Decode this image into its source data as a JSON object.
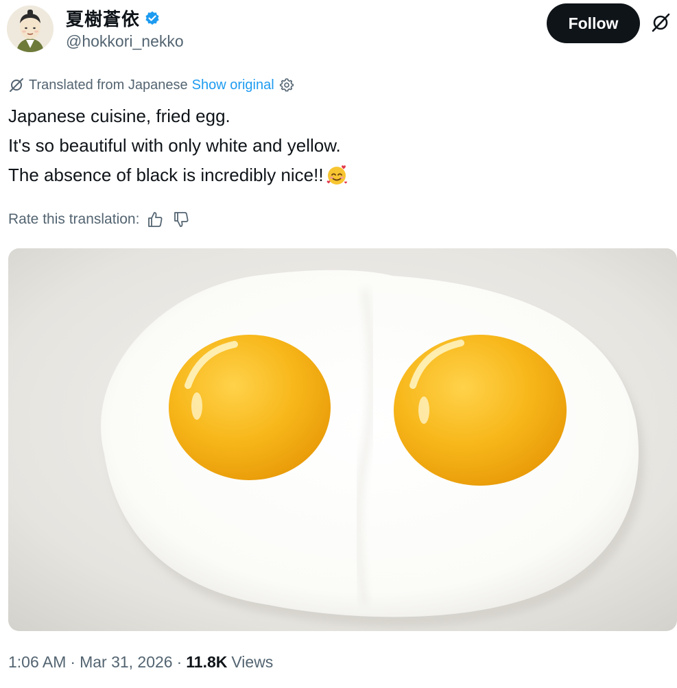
{
  "author": {
    "display_name": "夏樹蒼依",
    "handle": "@hokkori_nekko",
    "verified": true,
    "avatar_icon": "samurai-avatar-icon"
  },
  "actions": {
    "follow_label": "Follow",
    "grok_icon": "grok-icon"
  },
  "translation": {
    "translated_from": "Translated from Japanese",
    "show_original": "Show original",
    "settings_icon": "gear-icon"
  },
  "tweet": {
    "lines": [
      "Japanese cuisine, fried egg.",
      "It's so beautiful with only white and yellow.",
      "The absence of black is incredibly nice!!"
    ],
    "emoji": "smiling-face-with-hearts"
  },
  "rating": {
    "label": "Rate this translation:",
    "up_icon": "thumbs-up-icon",
    "down_icon": "thumbs-down-icon"
  },
  "media": {
    "kind": "photo",
    "subject": "two fried eggs sunny side up on a white plate"
  },
  "meta": {
    "time": "1:06 AM",
    "separator": "·",
    "date": "Mar 31, 2026",
    "views_count": "11.8K",
    "views_label": "Views"
  },
  "colors": {
    "text": "#0f1419",
    "secondary": "#536471",
    "link": "#1d9bf0",
    "follow_bg": "#0f1419",
    "yolk": "#f7b71a"
  }
}
